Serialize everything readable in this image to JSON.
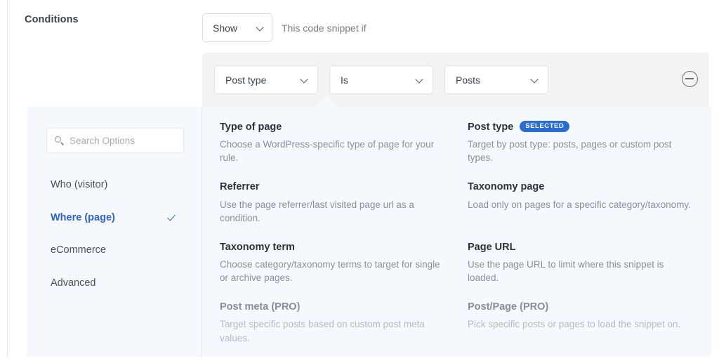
{
  "page": {
    "section_label": "Conditions"
  },
  "visibility": {
    "select_value": "Show",
    "helper_text": "This code snippet if",
    "dropdown_icon": "chevron-down-icon"
  },
  "rule": {
    "subject": "Post type",
    "operator": "Is",
    "value": "Posts",
    "remove_icon": "minus-circle-icon"
  },
  "sidebar": {
    "search": {
      "placeholder": "Search Options",
      "value": "",
      "icon": "search-icon"
    },
    "items": [
      {
        "label": "Who (visitor)",
        "active": false
      },
      {
        "label": "Where (page)",
        "active": true,
        "icon": "check-icon"
      },
      {
        "label": "eCommerce",
        "active": false
      },
      {
        "label": "Advanced",
        "active": false
      }
    ]
  },
  "options": {
    "selected_badge": "SELECTED",
    "items": [
      {
        "title": "Type of page",
        "desc": "Choose a WordPress-specific type of page for your rule.",
        "selected": false,
        "pro": false
      },
      {
        "title": "Post type",
        "desc": "Target by post type: posts, pages or custom post types.",
        "selected": true,
        "pro": false
      },
      {
        "title": "Referrer",
        "desc": "Use the page referrer/last visited page url as a condition.",
        "selected": false,
        "pro": false
      },
      {
        "title": "Taxonomy page",
        "desc": "Load only on pages for a specific category/taxonomy.",
        "selected": false,
        "pro": false
      },
      {
        "title": "Taxonomy term",
        "desc": "Choose category/taxonomy terms to target for single or archive pages.",
        "selected": false,
        "pro": false
      },
      {
        "title": "Page URL",
        "desc": "Use the page URL to limit where this snippet is loaded.",
        "selected": false,
        "pro": false
      },
      {
        "title": "Post meta (PRO)",
        "desc": "Target specific posts based on custom post meta values.",
        "selected": false,
        "pro": true
      },
      {
        "title": "Post/Page (PRO)",
        "desc": "Pick specific posts or pages to load the snippet on.",
        "selected": false,
        "pro": true
      }
    ]
  },
  "colors": {
    "accent": "#2f62c8",
    "badge": "#2a6ccf",
    "panel_bg": "#f5f8fd",
    "band_bg": "#f4f3f3"
  }
}
